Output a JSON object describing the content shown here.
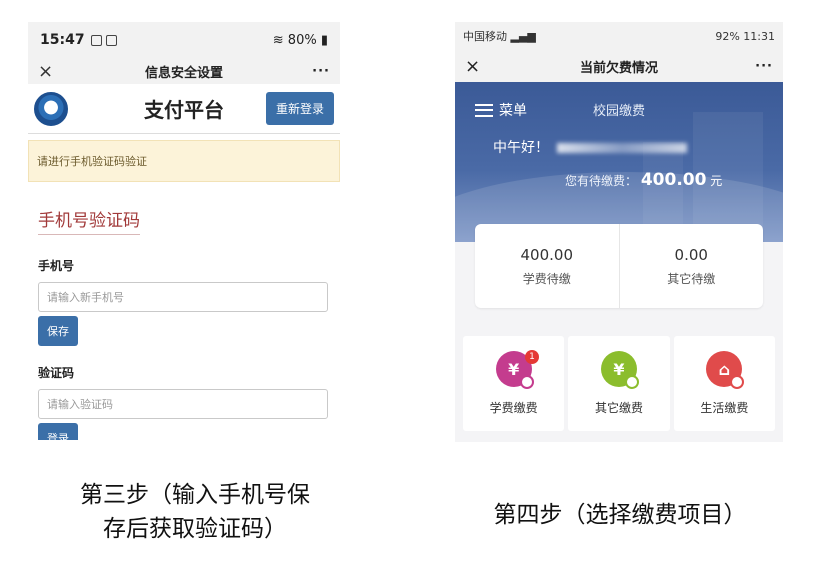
{
  "left_phone": {
    "status": {
      "time": "15:47",
      "right": "80%"
    },
    "nav": {
      "close": "×",
      "title": "信息安全设置",
      "more": "···"
    },
    "header": {
      "title": "支付平台",
      "relogin": "重新登录"
    },
    "alert": "请进行手机验证码验证",
    "section_title": "手机号验证码",
    "phone": {
      "label": "手机号",
      "placeholder": "请输入新手机号",
      "save": "保存"
    },
    "code": {
      "label": "验证码",
      "placeholder": "请输入验证码",
      "login": "登录"
    }
  },
  "right_phone": {
    "status": {
      "left": "中国移动",
      "right": "92%  11:31"
    },
    "nav": {
      "close": "×",
      "title": "当前欠费情况",
      "more": "···"
    },
    "banner": {
      "menu": "菜单",
      "campus_pay": "校园缴费",
      "greeting": "中午好！",
      "owed_label": "您有待缴费：",
      "owed_amount": "400.00",
      "owed_unit": "元"
    },
    "summary": [
      {
        "value": "400.00",
        "label": "学费待缴"
      },
      {
        "value": "0.00",
        "label": "其它待缴"
      }
    ],
    "actions": [
      {
        "label": "学费缴费",
        "glyph": "¥",
        "badge": "1",
        "color": "#c43c8e"
      },
      {
        "label": "其它缴费",
        "glyph": "¥",
        "color": "#8bbd2d"
      },
      {
        "label": "生活缴费",
        "glyph": "⌂",
        "color": "#e04b4b"
      }
    ]
  },
  "captions": {
    "left_line1": "第三步（输入手机号保",
    "left_line2": "存后获取验证码）",
    "right": "第四步（选择缴费项目）"
  }
}
